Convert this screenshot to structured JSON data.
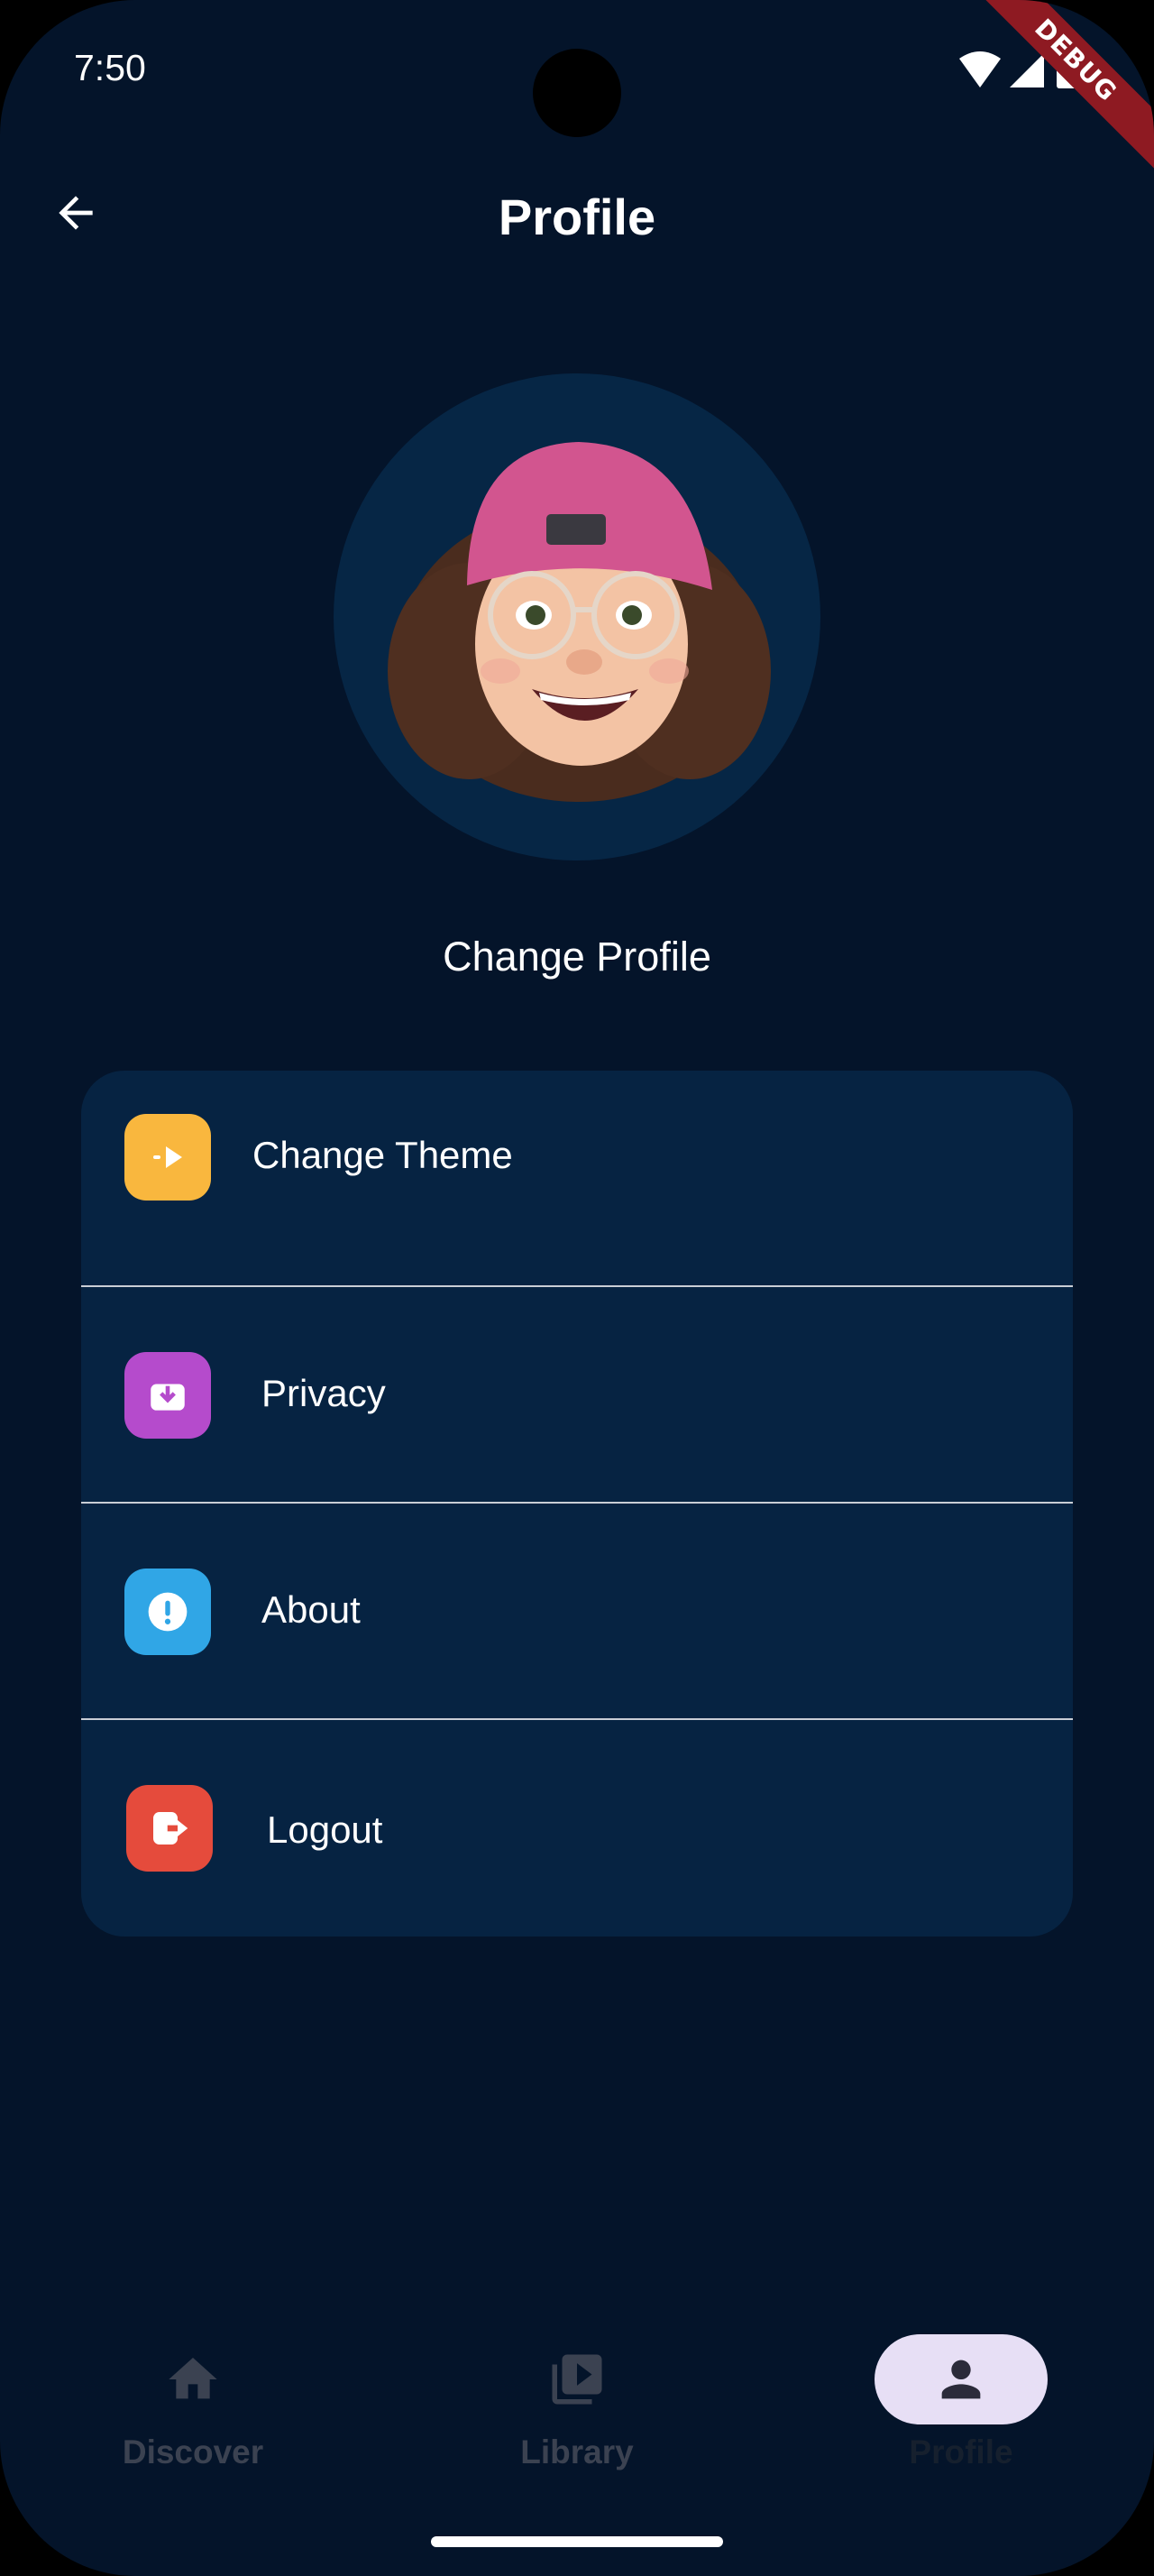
{
  "status_bar": {
    "time": "7:50",
    "debug_label": "DEBUG"
  },
  "app_bar": {
    "title": "Profile",
    "back_icon": "arrow-left-icon"
  },
  "profile": {
    "avatar": "memoji-avatar",
    "change_profile_label": "Change Profile"
  },
  "menu": {
    "items": [
      {
        "label": "Change Theme",
        "icon": "theme-icon",
        "icon_color": "#f9b73e"
      },
      {
        "label": "Privacy",
        "icon": "privacy-icon",
        "icon_color": "#b54bcc"
      },
      {
        "label": "About",
        "icon": "about-icon",
        "icon_color": "#30a6e6"
      },
      {
        "label": "Logout",
        "icon": "logout-icon",
        "icon_color": "#e54b3c"
      }
    ]
  },
  "bottom_nav": {
    "items": [
      {
        "label": "Discover",
        "icon": "home-icon",
        "active": false
      },
      {
        "label": "Library",
        "icon": "library-icon",
        "active": false
      },
      {
        "label": "Profile",
        "icon": "person-icon",
        "active": true
      }
    ]
  },
  "colors": {
    "background": "#04142a",
    "card": "#062342",
    "avatar_bg": "#062645",
    "active_nav_pill": "#e7dff5"
  }
}
